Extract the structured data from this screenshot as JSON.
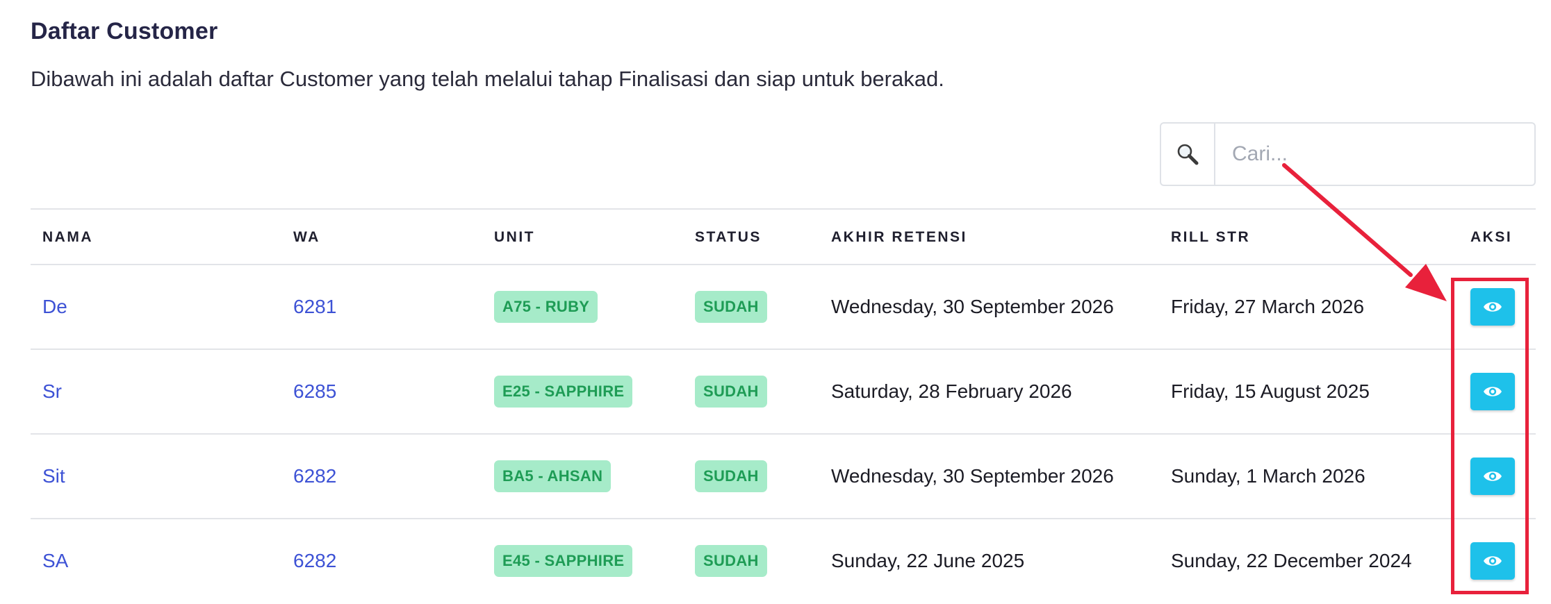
{
  "page": {
    "title": "Daftar Customer",
    "description": "Dibawah ini adalah daftar Customer yang telah melalui tahap Finalisasi dan siap untuk berakad."
  },
  "search": {
    "placeholder": "Cari...",
    "value": "",
    "icon": "search-icon"
  },
  "table": {
    "headers": [
      "NAMA",
      "WA",
      "UNIT",
      "STATUS",
      "AKHIR RETENSI",
      "RILL STR",
      "AKSI"
    ],
    "rows": [
      {
        "nama": "De",
        "wa": "6281",
        "unit": "A75 - RUBY",
        "status": "SUDAH",
        "akhir_retensi": "Wednesday, 30 September 2026",
        "rill_str": "Friday, 27 March 2026",
        "aksi_icon": "eye-icon"
      },
      {
        "nama": "Sr",
        "wa": "6285",
        "unit": "E25 - SAPPHIRE",
        "status": "SUDAH",
        "akhir_retensi": "Saturday, 28 February 2026",
        "rill_str": "Friday, 15 August 2025",
        "aksi_icon": "eye-icon"
      },
      {
        "nama": "Sit",
        "wa": "6282",
        "unit": "BA5 - AHSAN",
        "status": "SUDAH",
        "akhir_retensi": "Wednesday, 30 September 2026",
        "rill_str": "Sunday, 1 March 2026",
        "aksi_icon": "eye-icon"
      },
      {
        "nama": "SA",
        "wa": "6282",
        "unit": "E45 - SAPPHIRE",
        "status": "SUDAH",
        "akhir_retensi": "Sunday, 22 June 2025",
        "rill_str": "Sunday, 22 December 2024",
        "aksi_icon": "eye-icon"
      }
    ]
  },
  "colors": {
    "link": "#3d52d5",
    "badge_bg": "#a6ebc9",
    "badge_text": "#1e9c55",
    "view_button": "#1ec1ea",
    "annotation": "#e8213b"
  }
}
